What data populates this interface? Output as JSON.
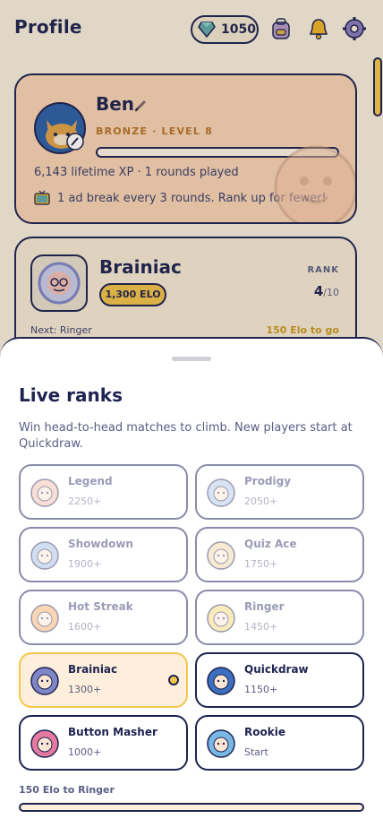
{
  "header": {
    "title": "Profile",
    "gems": "1050"
  },
  "profile": {
    "name": "Ben",
    "level_line": "BRONZE · LEVEL 8",
    "stats": "6,143 lifetime XP · 1 rounds played",
    "ad_note": "1 ad break every 3 rounds. Rank up for fewer!"
  },
  "rank_card": {
    "name": "Brainiac",
    "elo": "1,300 ELO",
    "rank_label": "RANK",
    "rank_pos": "4",
    "rank_of": "/10",
    "next": "Next: Ringer",
    "to_go": "150 Elo to go"
  },
  "sheet": {
    "title": "Live ranks",
    "description": "Win head-to-head matches to climb. New players start at Quickdraw.",
    "ranks": [
      {
        "name": "Legend",
        "elo": "2250+",
        "state": "locked",
        "color": "#f4b9a6"
      },
      {
        "name": "Prodigy",
        "elo": "2050+",
        "state": "locked",
        "color": "#a9c4e6"
      },
      {
        "name": "Showdown",
        "elo": "1900+",
        "state": "locked",
        "color": "#9bb4e0"
      },
      {
        "name": "Quiz Ace",
        "elo": "1750+",
        "state": "locked",
        "color": "#f3d1a2"
      },
      {
        "name": "Hot Streak",
        "elo": "1600+",
        "state": "locked",
        "color": "#f7a65a"
      },
      {
        "name": "Ringer",
        "elo": "1450+",
        "state": "locked",
        "color": "#f4d56a"
      },
      {
        "name": "Brainiac",
        "elo": "1300+",
        "state": "current",
        "color": "#7f86c8"
      },
      {
        "name": "Quickdraw",
        "elo": "1150+",
        "state": "unlocked",
        "color": "#3c6fbf"
      },
      {
        "name": "Button Masher",
        "elo": "1000+",
        "state": "unlocked",
        "color": "#e77aa0"
      },
      {
        "name": "Rookie",
        "elo": "Start",
        "state": "unlocked",
        "color": "#79b8e6"
      }
    ],
    "progress_label": "150 Elo to Ringer",
    "progress_fraction": 0
  },
  "colors": {
    "navy": "#1e2350",
    "gold": "#f3c84a",
    "peach": "#f8d3b6"
  }
}
